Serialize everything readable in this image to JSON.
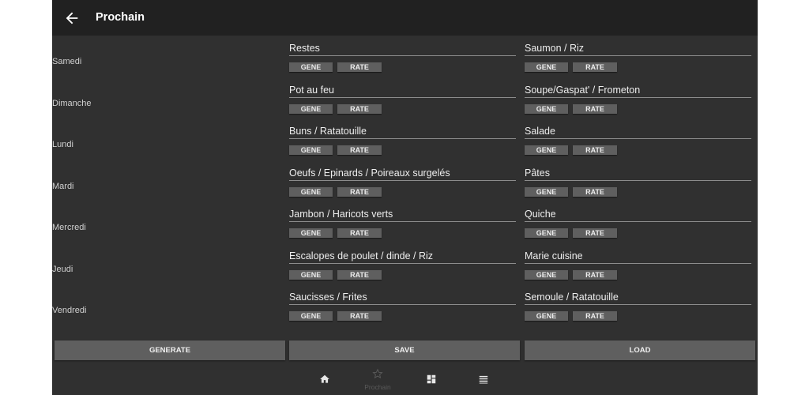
{
  "header": {
    "title": "Prochain",
    "back_icon": "arrow-left-icon"
  },
  "days": [
    {
      "name": "Samedi",
      "meals": [
        "Restes",
        "Saumon / Riz"
      ]
    },
    {
      "name": "Dimanche",
      "meals": [
        "Pot au feu",
        "Soupe/Gaspat' / Frometon"
      ]
    },
    {
      "name": "Lundi",
      "meals": [
        "Buns / Ratatouille",
        "Salade"
      ]
    },
    {
      "name": "Mardi",
      "meals": [
        "Oeufs / Epinards / Poireaux surgelés",
        "Pâtes"
      ]
    },
    {
      "name": "Mercredi",
      "meals": [
        "Jambon / Haricots verts",
        "Quiche"
      ]
    },
    {
      "name": "Jeudi",
      "meals": [
        "Escalopes de poulet / dinde / Riz",
        "Marie cuisine"
      ]
    },
    {
      "name": "Vendredi",
      "meals": [
        "Saucisses / Frites",
        "Semoule / Ratatouille"
      ]
    }
  ],
  "meal_buttons": {
    "gene_label": "GENE",
    "rate_label": "RATE"
  },
  "actions": {
    "generate_label": "GENERATE",
    "save_label": "SAVE",
    "load_label": "LOAD"
  },
  "bottom_nav": {
    "items": [
      {
        "icon": "home-icon"
      },
      {
        "icon": "star-icon",
        "label": "Prochain"
      },
      {
        "icon": "dashboard-icon"
      },
      {
        "icon": "list-icon"
      }
    ]
  },
  "colors": {
    "app_background": "#303030",
    "header_background": "#212121",
    "button": "#5f5f5f",
    "text": "#ffffff"
  }
}
